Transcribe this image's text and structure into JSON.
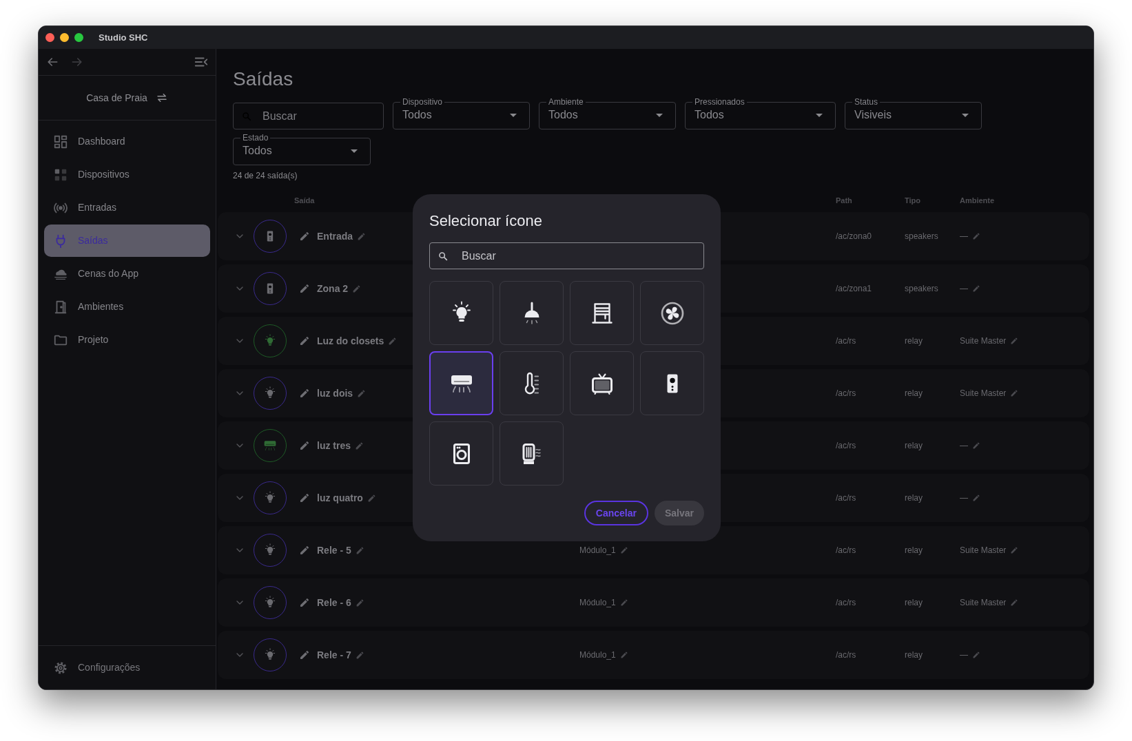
{
  "window": {
    "title": "Studio SHC"
  },
  "sidebar": {
    "project": "Casa de Praia",
    "items": [
      {
        "label": "Dashboard",
        "kind": "dashboard",
        "selected": false
      },
      {
        "label": "Dispositivos",
        "kind": "devices",
        "selected": false
      },
      {
        "label": "Entradas",
        "kind": "antenna",
        "selected": false
      },
      {
        "label": "Saídas",
        "kind": "plug",
        "selected": true
      },
      {
        "label": "Cenas do App",
        "kind": "cloud",
        "selected": false
      },
      {
        "label": "Ambientes",
        "kind": "door",
        "selected": false
      },
      {
        "label": "Projeto",
        "kind": "folder",
        "selected": false
      }
    ],
    "footer": {
      "label": "Configurações"
    }
  },
  "page": {
    "title": "Saídas",
    "search": {
      "placeholder": "Buscar"
    },
    "filters": [
      {
        "label": "Dispositivo",
        "value": "Todos"
      },
      {
        "label": "Ambiente",
        "value": "Todos"
      },
      {
        "label": "Pressionados",
        "value": "Todos"
      },
      {
        "label": "Status",
        "value": "Visiveis"
      },
      {
        "label": "Estado",
        "value": "Todos"
      }
    ],
    "count": "24 de 24 saída(s)"
  },
  "table": {
    "columns": [
      "Saída",
      "Path",
      "Tipo",
      "Ambiente"
    ],
    "rows": [
      {
        "name": "Entrada",
        "kind": "speaker",
        "color": "#3a2a8c",
        "path": "/ac/zona0",
        "tipo": "speakers",
        "ambiente": "—"
      },
      {
        "name": "Zona 2",
        "kind": "speaker",
        "color": "#3a2a8c",
        "path": "/ac/zona1",
        "tipo": "speakers",
        "ambiente": "—"
      },
      {
        "name": "Luz do closets",
        "kind": "bulb",
        "color": "#1e5a26",
        "path": "/ac/rs",
        "tipo": "relay",
        "ambiente": "Suite Master"
      },
      {
        "name": "luz dois",
        "kind": "bulb",
        "color": "#3a2a8c",
        "path": "/ac/rs",
        "tipo": "relay",
        "ambiente": "Suite Master"
      },
      {
        "name": "luz tres",
        "kind": "ac",
        "color": "#1e5a26",
        "path": "/ac/rs",
        "tipo": "relay",
        "ambiente": "—"
      },
      {
        "name": "luz quatro",
        "kind": "bulb",
        "color": "#3a2a8c",
        "path": "/ac/rs",
        "tipo": "relay",
        "ambiente": "—"
      },
      {
        "name": "Rele - 5",
        "kind": "bulb",
        "color": "#3a2a8c",
        "device": "Módulo_1",
        "path": "/ac/rs",
        "tipo": "relay",
        "ambiente": "Suite Master"
      },
      {
        "name": "Rele - 6",
        "kind": "bulb",
        "color": "#3a2a8c",
        "device": "Módulo_1",
        "path": "/ac/rs",
        "tipo": "relay",
        "ambiente": "Suite Master"
      },
      {
        "name": "Rele - 7",
        "kind": "bulb",
        "color": "#3a2a8c",
        "device": "Módulo_1",
        "path": "/ac/rs",
        "tipo": "relay",
        "ambiente": "—"
      }
    ]
  },
  "modal": {
    "title": "Selecionar ícone",
    "search": {
      "placeholder": "Buscar"
    },
    "icons": [
      {
        "kind": "bulb",
        "selected": false
      },
      {
        "kind": "pendant",
        "selected": false
      },
      {
        "kind": "shutter",
        "selected": false
      },
      {
        "kind": "fan",
        "selected": false
      },
      {
        "kind": "ac",
        "selected": true
      },
      {
        "kind": "thermo",
        "selected": false
      },
      {
        "kind": "tv",
        "selected": false
      },
      {
        "kind": "speaker",
        "selected": false
      },
      {
        "kind": "washer",
        "selected": false
      },
      {
        "kind": "heater",
        "selected": false
      }
    ],
    "buttons": [
      {
        "label": "Cancelar",
        "kind": "outline",
        "disabled": false
      },
      {
        "label": "Salvar",
        "kind": "filled",
        "disabled": true
      }
    ]
  }
}
